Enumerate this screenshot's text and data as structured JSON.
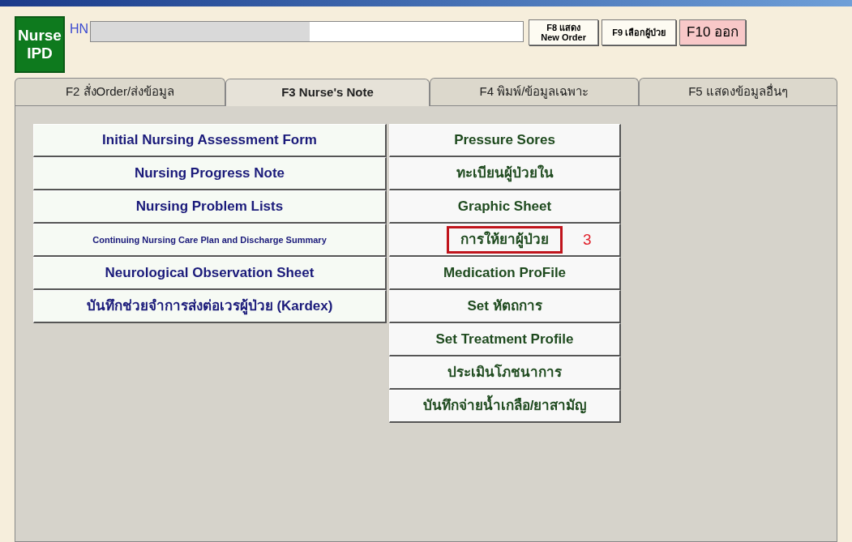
{
  "badge": {
    "line1": "Nurse",
    "line2": "IPD"
  },
  "hn": {
    "label": "HN"
  },
  "buttons": [
    {
      "line1": "F8 แสดง",
      "line2": "New Order",
      "kind": "small"
    },
    {
      "line1": "F9 เลือกผู้ป่วย",
      "kind": "medium"
    },
    {
      "line1": "F10 ออก",
      "kind": "exit"
    }
  ],
  "tabs": [
    {
      "label": "F2 สั่งOrder/ส่งข้อมูล",
      "selected": false
    },
    {
      "label": "F3 Nurse's Note",
      "selected": true
    },
    {
      "label": "F4 พิมพ์/ข้อมูลเฉพาะ",
      "selected": false
    },
    {
      "label": "F5 แสดงข้อมูลอื่นๆ",
      "selected": false
    }
  ],
  "left_buttons": [
    {
      "label": "Initial Nursing Assessment Form",
      "kind": "normal"
    },
    {
      "label": "Nursing Progress Note",
      "kind": "normal"
    },
    {
      "label": "Nursing Problem Lists",
      "kind": "normal"
    },
    {
      "label": "Continuing Nursing Care Plan and Discharge Summary",
      "kind": "small"
    },
    {
      "label": "Neurological Observation Sheet",
      "kind": "normal"
    },
    {
      "label": "บันทึกช่วยจำการส่งต่อเวรผู้ป่วย (Kardex)",
      "kind": "normal"
    }
  ],
  "right_buttons": [
    {
      "label": "Pressure Sores",
      "highlighted": false
    },
    {
      "label": "ทะเบียนผู้ป่วยใน",
      "highlighted": false
    },
    {
      "label": "Graphic Sheet",
      "highlighted": false
    },
    {
      "label": "การให้ยาผู้ป่วย",
      "highlighted": true,
      "annotation": "3"
    },
    {
      "label": "Medication ProFile",
      "highlighted": false
    },
    {
      "label": "Set หัตถการ",
      "highlighted": false
    },
    {
      "label": "Set Treatment Profile",
      "highlighted": false
    },
    {
      "label": "ประเมินโภชนาการ",
      "highlighted": false
    },
    {
      "label": "บันทึกจ่ายน้ำเกลือ/ยาสามัญ",
      "highlighted": false
    }
  ]
}
